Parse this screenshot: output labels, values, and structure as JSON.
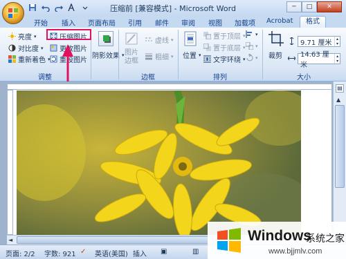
{
  "window": {
    "title": "压缩前 [兼容模式] - Microsoft Word",
    "controls": {
      "minimize": "─",
      "restore": "□",
      "close": "✕"
    }
  },
  "quick_access": {
    "icons": [
      "save-icon",
      "undo-icon",
      "redo-icon",
      "text-effect-icon",
      "customize-icon"
    ]
  },
  "tabs": [
    {
      "label": "开始",
      "active": false
    },
    {
      "label": "插入",
      "active": false
    },
    {
      "label": "页面布局",
      "active": false
    },
    {
      "label": "引用",
      "active": false
    },
    {
      "label": "邮件",
      "active": false
    },
    {
      "label": "审阅",
      "active": false
    },
    {
      "label": "视图",
      "active": false
    },
    {
      "label": "加载项",
      "active": false
    },
    {
      "label": "Acrobat",
      "active": false
    },
    {
      "label": "格式",
      "active": true
    }
  ],
  "ribbon": {
    "adjust": {
      "label": "调整",
      "brightness": "亮度",
      "contrast": "对比度",
      "recolor": "重新着色",
      "compress": "压缩图片",
      "change": "更改图片",
      "reset": "重设图片"
    },
    "shadow": {
      "label": "阴影效果"
    },
    "border": {
      "label": "边框",
      "picture_border": "图片边框",
      "dashes": "虚线",
      "weight": "粗细"
    },
    "arrange": {
      "label": "排列",
      "position": "位置",
      "bring_front": "置于顶层",
      "send_back": "置于底层",
      "text_wrap": "文字环绕"
    },
    "size": {
      "label": "大小",
      "crop": "裁剪",
      "height": "9.71 厘米",
      "width": "14.63 厘米"
    }
  },
  "status": {
    "page": "页面: 2/2",
    "words": "字数: 921",
    "language": "英语(美国)",
    "mode": "插入"
  },
  "watermark": {
    "brand": "Windows",
    "subtitle": "系统之家",
    "url": "www.bjjmlv.com"
  },
  "colors": {
    "highlight": "#e0115f",
    "ribbon_bg": "#dbe7f6",
    "flower": "#f3d51b"
  }
}
